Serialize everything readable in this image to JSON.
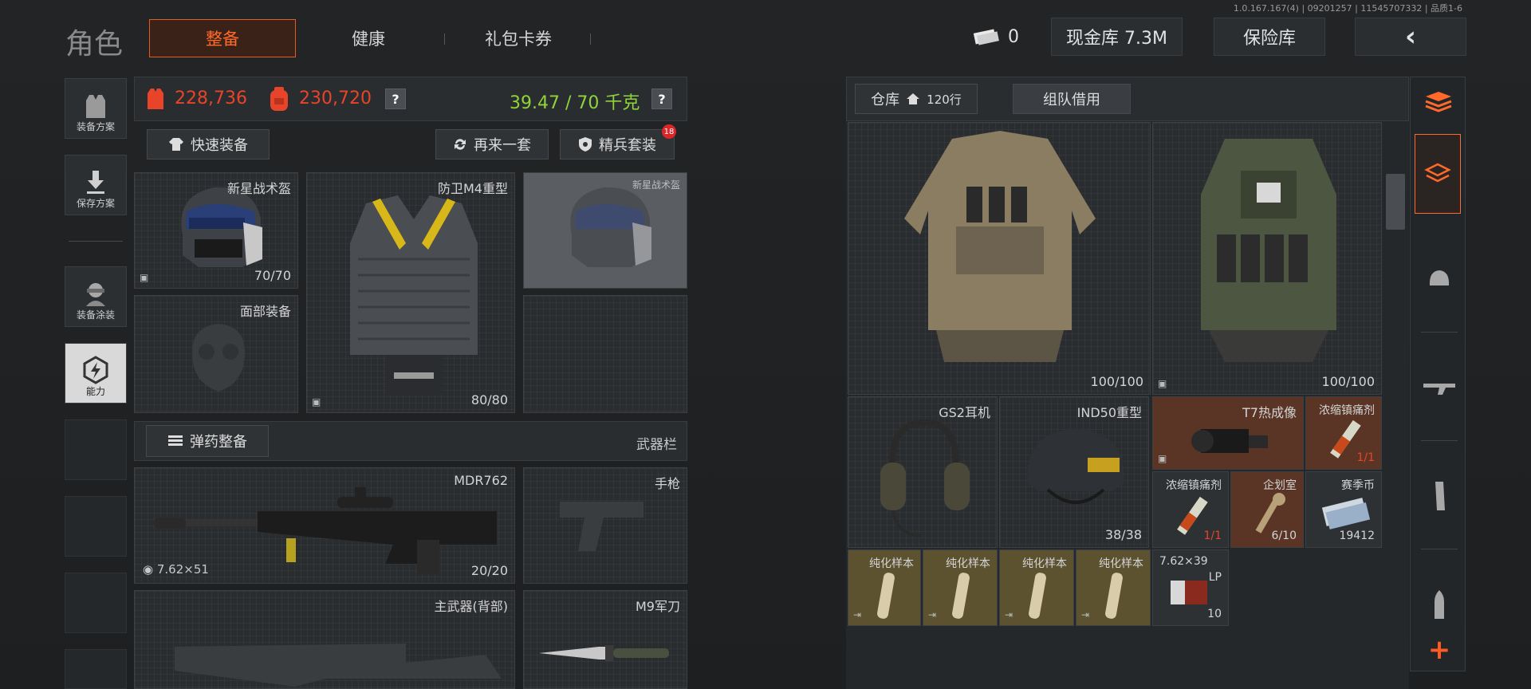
{
  "version": "1.0.167.167(4) | 09201257 | 11545707332 | 品质1-6",
  "header": {
    "title": "角色",
    "tabs": [
      "整备",
      "健康",
      "礼包卡券"
    ],
    "cash": "0",
    "vault": "现金库 7.3M",
    "insurance": "保险库",
    "back": "‹"
  },
  "side": {
    "items": [
      "装备方案",
      "保存方案",
      "装备涂装",
      "能力"
    ]
  },
  "stats": {
    "armor_value": "228,736",
    "bag_value": "230,720",
    "q": "?",
    "weight": "39.47 / 70 千克"
  },
  "buttons": {
    "quick": "快速装备",
    "again": "再来一套",
    "elite": "精兵套装",
    "elite_badge": "18",
    "ammo": "弹药整备",
    "weapon_bar": "武器栏"
  },
  "slots": {
    "helmet": {
      "name": "新星战术盔",
      "count": "70/70"
    },
    "armor": {
      "name": "防卫M4重型",
      "count": "80/80"
    },
    "helmet2": {
      "name": "新星战术盔"
    },
    "face": {
      "name": "面部装备"
    },
    "primary": {
      "name": "MDR762",
      "ammo": "7.62×51",
      "count": "20/20"
    },
    "pistol": {
      "name": "手枪"
    },
    "back": {
      "name": "主武器(背部)"
    },
    "knife": {
      "name": "M9军刀"
    }
  },
  "storage": {
    "tab_warehouse": "仓库",
    "rows": "120行",
    "tab_team": "组队借用",
    "items": [
      {
        "name": "",
        "count": "100/100"
      },
      {
        "name": "",
        "count": "100/100"
      },
      {
        "name": "GS2耳机",
        "count": ""
      },
      {
        "name": "IND50重型",
        "count": "38/38"
      },
      {
        "name": "T7热成像",
        "count": ""
      },
      {
        "name": "浓缩镇痛剂",
        "count": "1/1"
      },
      {
        "name": "浓缩镇痛剂",
        "count": "1/1"
      },
      {
        "name": "企划室",
        "count": "6/10"
      },
      {
        "name": "赛季币",
        "count": "19412"
      },
      {
        "name": "纯化样本",
        "count": ""
      },
      {
        "name": "纯化样本",
        "count": ""
      },
      {
        "name": "纯化样本",
        "count": ""
      },
      {
        "name": "纯化样本",
        "count": ""
      },
      {
        "name": "7.62×39",
        "sub": "LP",
        "count": "10"
      }
    ]
  },
  "colors": {
    "accent": "#ff6a2a",
    "green": "#8fd43a",
    "rare": "#5a3526",
    "gold": "#5c5230"
  }
}
